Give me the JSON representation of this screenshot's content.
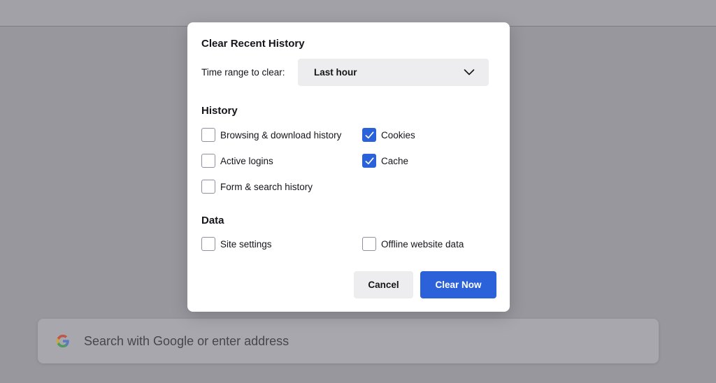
{
  "dialog": {
    "title": "Clear Recent History",
    "time_range_label": "Time range to clear:",
    "time_range_value": "Last hour",
    "history_section": {
      "title": "History",
      "items": [
        {
          "label": "Browsing & download history",
          "checked": false
        },
        {
          "label": "Cookies",
          "checked": true
        },
        {
          "label": "Active logins",
          "checked": false
        },
        {
          "label": "Cache",
          "checked": true
        },
        {
          "label": "Form & search history",
          "checked": false
        }
      ]
    },
    "data_section": {
      "title": "Data",
      "items": [
        {
          "label": "Site settings",
          "checked": false
        },
        {
          "label": "Offline website data",
          "checked": false
        }
      ]
    },
    "cancel_label": "Cancel",
    "clear_label": "Clear Now"
  },
  "search": {
    "placeholder": "Search with Google or enter address",
    "icon": "google-g-icon"
  },
  "colors": {
    "accent": "#2b62d9",
    "overlay": "#98979d"
  }
}
